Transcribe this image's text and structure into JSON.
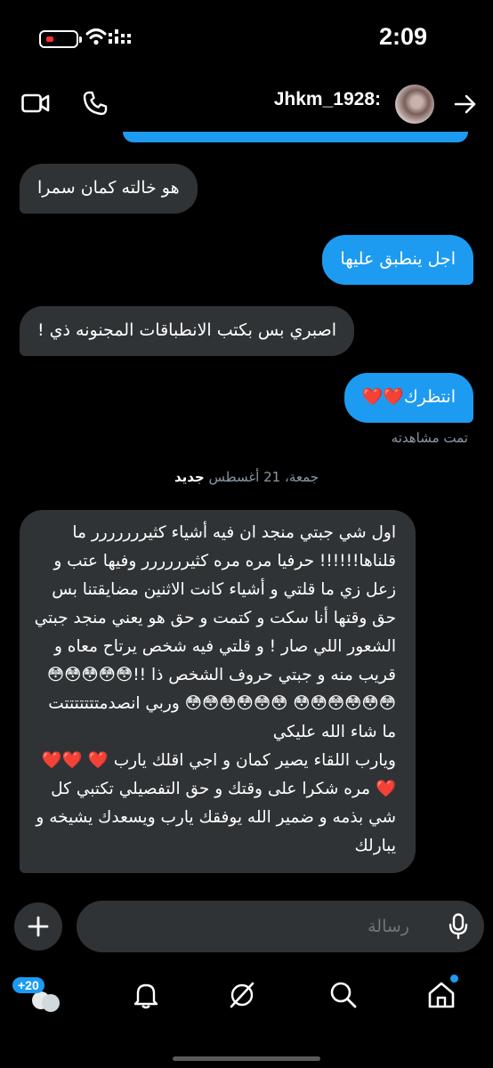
{
  "status_bar": {
    "time": "2:09"
  },
  "header": {
    "username": "Jhkm_1928:"
  },
  "messages": {
    "m1": "هو خالته كمان سمرا",
    "m2": "اجل ينطبق عليها",
    "m3": "اصبري بس بكتب الانطباقات المجنونه ذي !",
    "m4": "انتظرك❤️❤️",
    "seen": "تمت مشاهدته",
    "m5": "اول شي جبتي منجد ان فيه أشياء كثيررررررر ما قلناها!!!!!! حرفيا مره مره كثيرررررر وفيها عتب و زعل زي ما قلتي و أشياء كانت الاثنين مضايقتنا بس حق وقتها أنا سكت و كتمت و حق هو يعني منجد جبتي الشعور اللي صار ! و قلتي فيه شخص يرتاح معاه و قريب منه و جبتي حروف الشخص ذا !!😳😳😳😳😳😳😳😳😳😳😳 😳😳😳😳😳😳 وربي انصدمتتتتتتتت ما شاء الله عليكي\nويارب اللقاء يصير كمان و اجي اقلك يارب ❤️ ❤️❤️❤️ مره شكرا على وقتك و حق التفصيلي تكتبي كل شي بذمه و ضمير الله يوفقك يارب ويسعدك يشيخه و يبارلك"
  },
  "divider": {
    "date": "جمعة، 21 أغسطس",
    "new_label": "جديد"
  },
  "composer": {
    "placeholder": "رسالة"
  },
  "nav": {
    "badge": "+20"
  },
  "colors": {
    "accent": "#1d9bf0",
    "incoming": "#2f3336",
    "background": "#000000",
    "muted": "#8b98a5"
  },
  "icons": [
    "video-call-icon",
    "phone-icon",
    "arrow-right-icon",
    "plus-icon",
    "mic-icon",
    "chat-bubbles-icon",
    "bell-icon",
    "grok-slash-icon",
    "search-icon",
    "home-icon"
  ]
}
